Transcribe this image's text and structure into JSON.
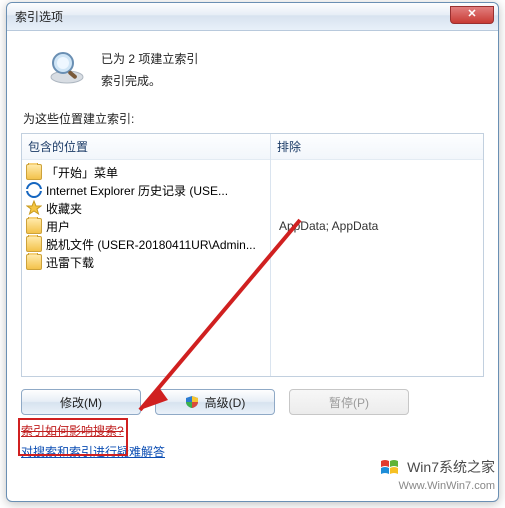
{
  "window": {
    "title": "索引选项"
  },
  "status": {
    "line1": "已为 2 项建立索引",
    "line2": "索引完成。"
  },
  "section_label": "为这些位置建立索引:",
  "columns": {
    "included": "包含的位置",
    "excluded": "排除"
  },
  "locations": [
    {
      "icon": "folder",
      "label": "「开始」菜单"
    },
    {
      "icon": "ie",
      "label": "Internet Explorer 历史记录 (USE..."
    },
    {
      "icon": "star",
      "label": "收藏夹"
    },
    {
      "icon": "folder",
      "label": "用户",
      "exclude": "AppData; AppData"
    },
    {
      "icon": "folder",
      "label": "脱机文件 (USER-20180411UR\\Admin..."
    },
    {
      "icon": "folder",
      "label": "迅雷下载"
    }
  ],
  "buttons": {
    "modify": "修改(M)",
    "advanced": "高级(D)",
    "pause": "暂停(P)"
  },
  "links": {
    "l1": "索引如何影响搜索?",
    "l2": "对搜索和索引进行疑难解答"
  },
  "watermark": {
    "brand": "Win7系统之家",
    "url": "Www.WinWin7.com"
  }
}
